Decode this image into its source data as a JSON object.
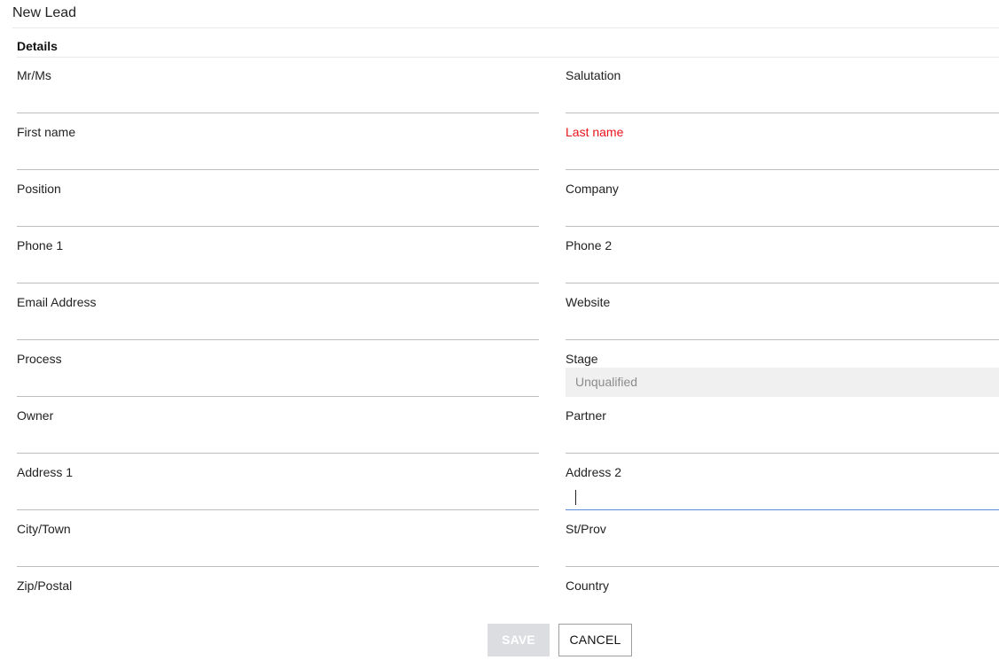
{
  "header": {
    "title": "New Lead"
  },
  "section": {
    "title": "Details"
  },
  "fields": {
    "mr_ms": {
      "label": "Mr/Ms",
      "value": ""
    },
    "salutation": {
      "label": "Salutation",
      "value": ""
    },
    "first_name": {
      "label": "First name",
      "value": ""
    },
    "last_name": {
      "label": "Last name",
      "value": "",
      "required": true,
      "label_color": "#e8141b"
    },
    "position": {
      "label": "Position",
      "value": ""
    },
    "company": {
      "label": "Company",
      "value": ""
    },
    "phone1": {
      "label": "Phone 1",
      "value": ""
    },
    "phone2": {
      "label": "Phone 2",
      "value": ""
    },
    "email": {
      "label": "Email Address",
      "value": ""
    },
    "website": {
      "label": "Website",
      "value": ""
    },
    "process": {
      "label": "Process",
      "value": ""
    },
    "stage": {
      "label": "Stage",
      "value": "Unqualified",
      "disabled": true
    },
    "owner": {
      "label": "Owner",
      "value": ""
    },
    "partner": {
      "label": "Partner",
      "value": ""
    },
    "address1": {
      "label": "Address 1",
      "value": ""
    },
    "address2": {
      "label": "Address 2",
      "value": "",
      "focused": true,
      "focus_color": "#5c8bd6"
    },
    "city": {
      "label": "City/Town",
      "value": ""
    },
    "st_prov": {
      "label": "St/Prov",
      "value": ""
    },
    "zip": {
      "label": "Zip/Postal",
      "value": ""
    },
    "country": {
      "label": "Country",
      "value": ""
    }
  },
  "actions": {
    "save_label": "SAVE",
    "save_disabled": true,
    "cancel_label": "CANCEL"
  }
}
